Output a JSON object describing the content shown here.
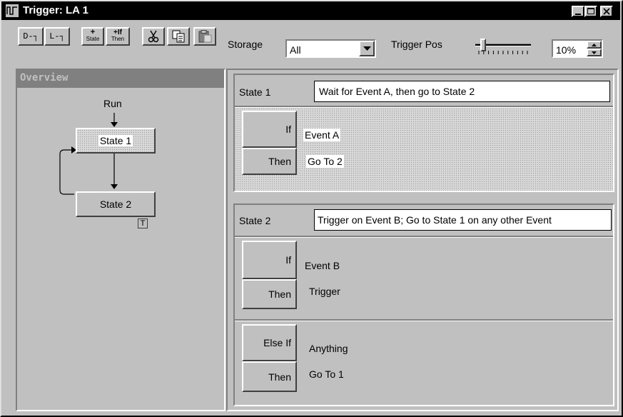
{
  "window": {
    "title": "Trigger: LA 1"
  },
  "toolbar": {
    "digital_btn": "D-┐",
    "level_btn": "L-┐",
    "add_state_top": "+",
    "add_state_bottom": "State",
    "add_ifthen_top": "+If",
    "add_ifthen_bottom": "Then",
    "storage_label": "Storage",
    "storage_value": "All",
    "trigger_pos_label": "Trigger Pos",
    "trigger_pos_value": "10%",
    "trigger_pos_fraction": 0.1
  },
  "overview": {
    "title": "Overview",
    "run_label": "Run",
    "state1_label": "State 1",
    "state2_label": "State 2",
    "trigger_marker": "T"
  },
  "states": [
    {
      "name": "State 1",
      "description": "Wait for Event A, then go to State 2",
      "clauses": [
        {
          "if_label": "If",
          "if_value": "Event A",
          "then_label": "Then",
          "then_value": "Go To 2"
        }
      ]
    },
    {
      "name": "State 2",
      "description": "Trigger on Event B;  Go to State 1 on any other Event",
      "clauses": [
        {
          "if_label": "If",
          "if_value": "Event B",
          "then_label": "Then",
          "then_value": "Trigger"
        },
        {
          "if_label": "Else If",
          "if_value": "Anything",
          "then_label": "Then",
          "then_value": "Go To 1"
        }
      ]
    }
  ]
}
